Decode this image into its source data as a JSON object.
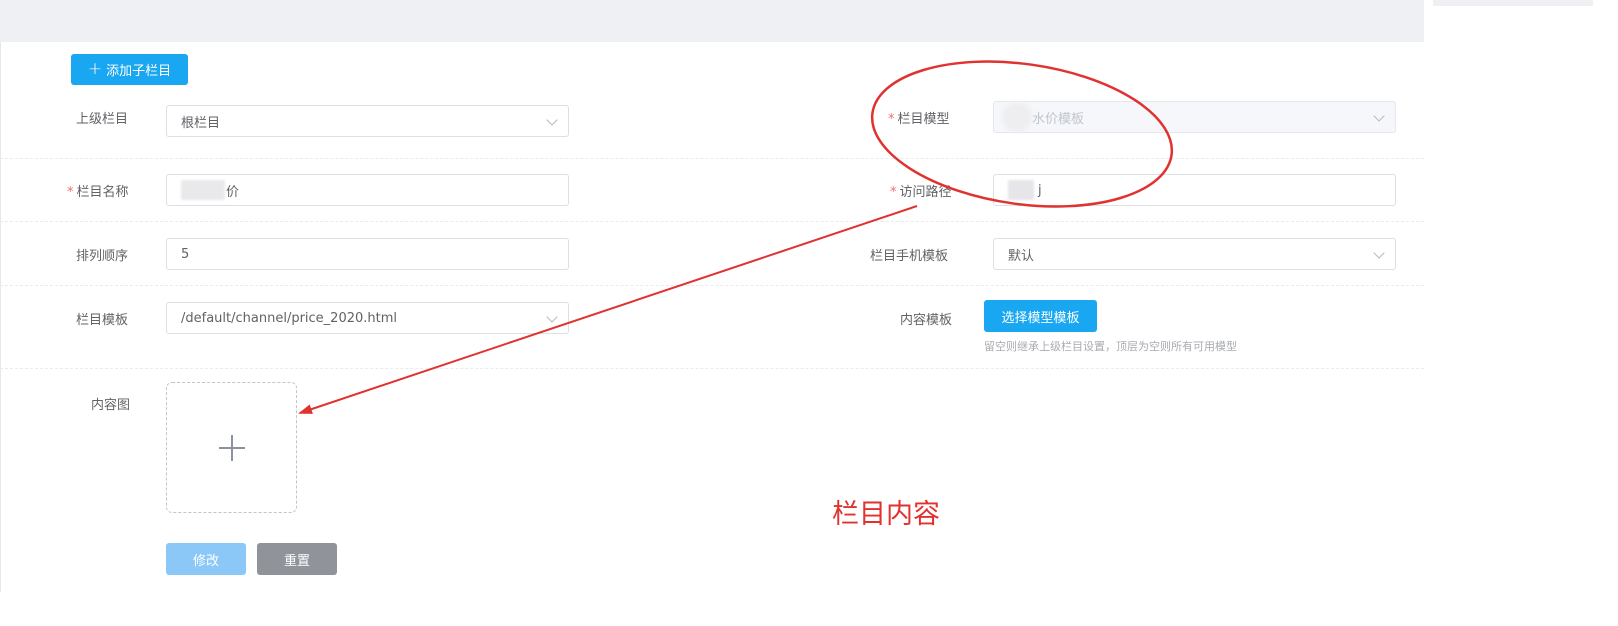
{
  "toolbar": {
    "add_child_label": "添加子栏目",
    "add_icon": "plus-icon"
  },
  "form": {
    "parent": {
      "label": "上级栏目",
      "value": "根栏目"
    },
    "model": {
      "label": "栏目模型",
      "required": "*",
      "value": "水价模板"
    },
    "name": {
      "label": "栏目名称",
      "required": "*",
      "value": "价"
    },
    "path": {
      "label": "访问路径",
      "required": "*",
      "value": "j"
    },
    "order": {
      "label": "排列顺序",
      "value": "5"
    },
    "mobile_template": {
      "label": "栏目手机模板",
      "value": "默认"
    },
    "channel_template": {
      "label": "栏目模板",
      "value": "/default/channel/price_2020.html"
    },
    "content_template": {
      "label": "内容模板",
      "button": "选择模型模板",
      "hint": "留空则继承上级栏目设置，顶层为空则所有可用模型"
    },
    "content_image": {
      "label": "内容图"
    }
  },
  "actions": {
    "submit": "修改",
    "reset": "重置"
  },
  "annotation": {
    "text": "栏目内容",
    "color": "#e0322f"
  },
  "colors": {
    "primary": "#1aa7f2",
    "required": "#f56c6c",
    "border": "#dcdfe6"
  }
}
